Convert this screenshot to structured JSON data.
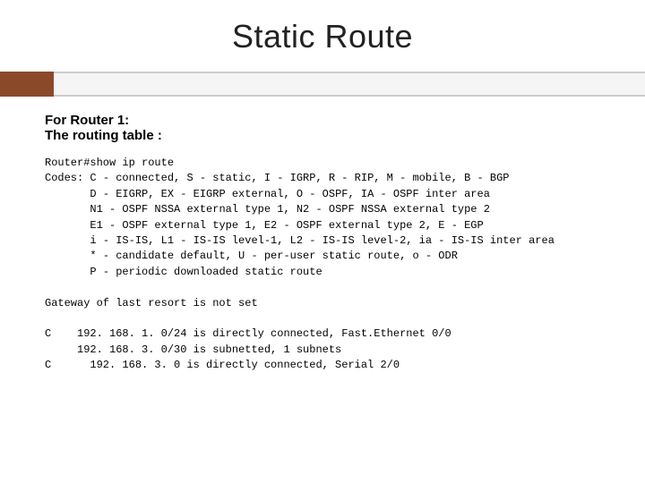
{
  "title": "Static Route",
  "intro_line_1": "For Router 1:",
  "intro_line_2": "The routing table :",
  "terminal": {
    "cmd": "Router#show ip route",
    "codes_prefix": "Codes: ",
    "codes_line_1": "C - connected, S - static, I - IGRP, R - RIP, M - mobile, B - BGP",
    "indent": "       ",
    "codes_line_2": "D - EIGRP, EX - EIGRP external, O - OSPF, IA - OSPF inter area",
    "codes_line_3": "N1 - OSPF NSSA external type 1, N2 - OSPF NSSA external type 2",
    "codes_line_4": "E1 - OSPF external type 1, E2 - OSPF external type 2, E - EGP",
    "codes_line_5": "i - IS-IS, L1 - IS-IS level-1, L2 - IS-IS level-2, ia - IS-IS inter area",
    "codes_line_6": "* - candidate default, U - per-user static route, o - ODR",
    "codes_line_7": "P - periodic downloaded static route",
    "blank": "",
    "gateway": "Gateway of last resort is not set",
    "route_1": "C    192. 168. 1. 0/24 is directly connected, Fast.Ethernet 0/0",
    "route_2": "     192. 168. 3. 0/30 is subnetted, 1 subnets",
    "route_3": "C      192. 168. 3. 0 is directly connected, Serial 2/0"
  }
}
